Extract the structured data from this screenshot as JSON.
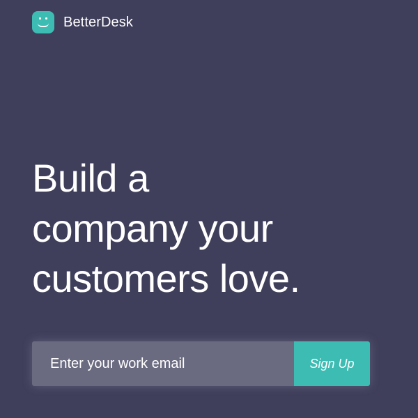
{
  "header": {
    "brand_name": "BetterDesk",
    "logo_icon": "smiley-face-icon"
  },
  "hero": {
    "headline_lines": [
      "Build a",
      "company your",
      "customers love."
    ]
  },
  "signup": {
    "email_placeholder": "Enter your work email",
    "email_value": "",
    "button_label": "Sign Up"
  },
  "colors": {
    "background": "#3f3f5b",
    "accent": "#3dbcb3",
    "input_background": "#6a6a80",
    "text": "#ffffff"
  }
}
